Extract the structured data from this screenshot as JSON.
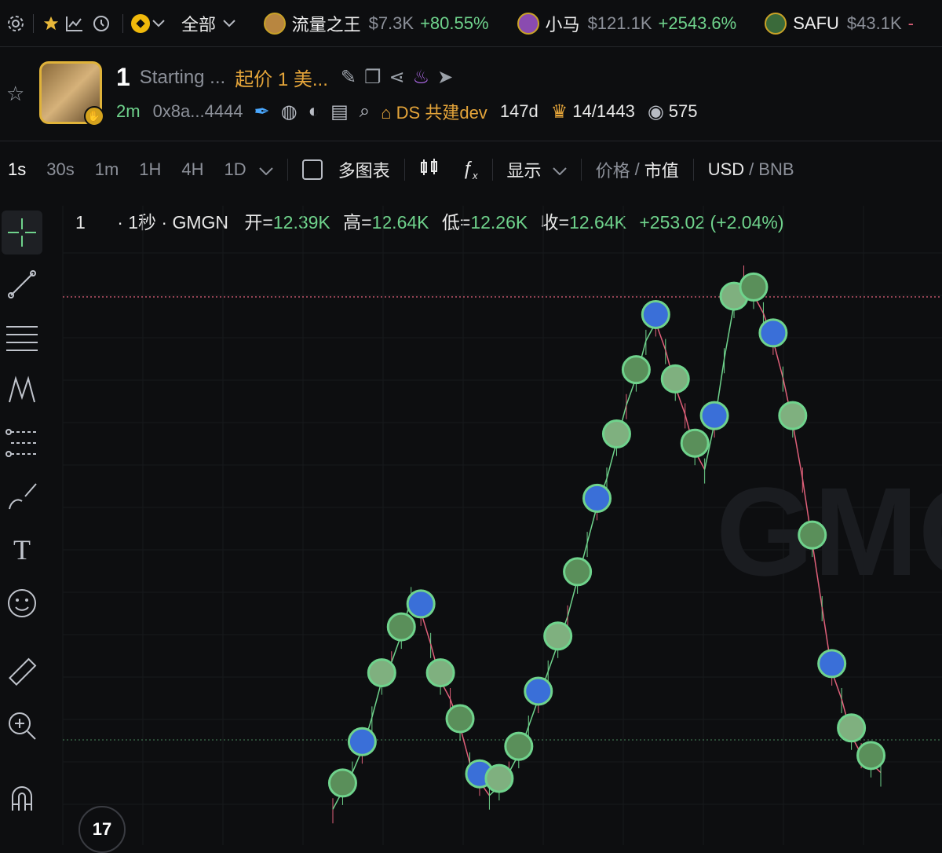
{
  "ticker": {
    "filter_label": "全部",
    "items": [
      {
        "name": "流量之王",
        "price": "$7.3K",
        "change": "+80.55%"
      },
      {
        "name": "小马",
        "price": "$121.1K",
        "change": "+2543.6%"
      },
      {
        "name": "SAFU",
        "price": "$43.1K",
        "change": "-"
      }
    ]
  },
  "token": {
    "symbol": "1",
    "name": "Starting ...",
    "subtitle": "起价 1 美...",
    "age": "2m",
    "address": "0x8a...4444",
    "dev": "DS 共建dev",
    "dev_age": "147d",
    "holders_ratio": "14/1443",
    "views": "575"
  },
  "toolbar": {
    "timeframes": [
      "1s",
      "30s",
      "1m",
      "1H",
      "4H",
      "1D"
    ],
    "active_timeframe": "1s",
    "multi_chart": "多图表",
    "display": "显示",
    "price_label": "价格",
    "mcap_label": "市值",
    "usd_label": "USD",
    "bnb_label": "BNB",
    "slash": "/"
  },
  "ohlc": {
    "symbol": "1",
    "interval": "· 1秒 · GMGN",
    "open_label": "开=",
    "open": "12.39K",
    "high_label": "高=",
    "high": "12.64K",
    "low_label": "低=",
    "low": "12.26K",
    "close_label": "收=",
    "close": "12.64K",
    "change": "+253.02 (+2.04%)"
  },
  "chart_data": {
    "type": "line",
    "watermark": "GMGN",
    "series": [
      {
        "values": [
          2,
          6,
          10,
          15,
          22,
          30,
          34,
          40,
          48,
          45,
          38,
          30,
          26,
          20,
          12,
          8,
          5,
          7,
          10,
          14,
          20,
          26,
          32,
          38,
          44,
          52,
          60,
          68,
          74,
          82,
          90,
          96,
          104,
          108,
          102,
          94,
          88,
          80,
          76,
          86,
          100,
          112,
          118,
          114,
          110,
          104,
          96,
          86,
          74,
          60,
          46,
          32,
          26,
          18,
          14,
          12,
          10
        ]
      }
    ],
    "colors": {
      "up": "#6fd38c",
      "down": "#e0607a"
    }
  },
  "tv_logo": "17"
}
